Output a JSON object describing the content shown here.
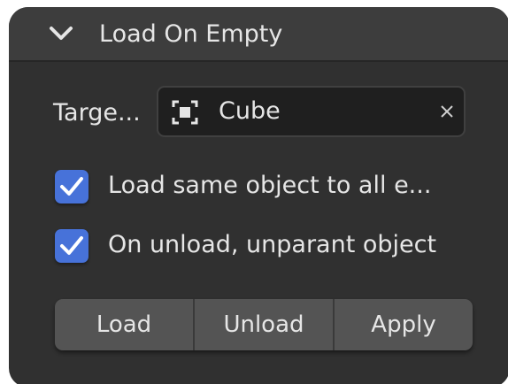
{
  "panel": {
    "title": "Load On Empty",
    "expanded": true,
    "chevron_icon": "chevron-down-icon"
  },
  "target": {
    "label": "Targe...",
    "value": "Cube",
    "object_icon": "object-icon",
    "clear_icon": "close-icon"
  },
  "options": [
    {
      "label": "Load same object to all e...",
      "checked": true
    },
    {
      "label": "On unload, unparant object",
      "checked": true
    }
  ],
  "buttons": [
    {
      "label": "Load"
    },
    {
      "label": "Unload"
    },
    {
      "label": "Apply"
    }
  ],
  "colors": {
    "panel_bg": "#303030",
    "header_bg": "#3d3d3d",
    "field_bg": "#1f1f1f",
    "checkbox_accent": "#4772d9",
    "button_bg": "#545454",
    "text": "#e6e6e6"
  }
}
